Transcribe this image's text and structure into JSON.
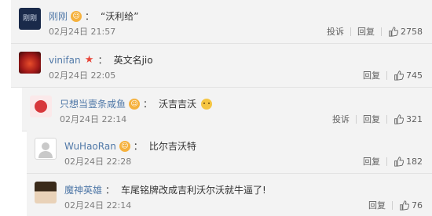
{
  "comments": [
    {
      "username": "刚刚",
      "text": "“沃利给”",
      "time": "02月24日 21:57",
      "actions": [
        "投诉",
        "回复"
      ],
      "likes": "2758",
      "avatar_label": "刚刚",
      "badge_color": "#f5b13d",
      "has_emoji": false
    },
    {
      "username": "vinifan",
      "text": "英文名jio",
      "time": "02月24日 22:05",
      "actions": [
        "回复"
      ],
      "likes": "745",
      "badge_color": "#e8463a",
      "has_emoji": false
    },
    {
      "username": "只想当壹条咸鱼",
      "text": "沃吉吉沃",
      "time": "02月24日 22:14",
      "actions": [
        "投诉",
        "回复"
      ],
      "likes": "321",
      "badge_color": "#f5b13d",
      "has_emoji": true
    },
    {
      "username": "WuHaoRan",
      "text": "比尔吉沃特",
      "time": "02月24日 22:28",
      "actions": [
        "回复"
      ],
      "likes": "182",
      "badge_color": "#f5b13d",
      "has_emoji": false
    },
    {
      "username": "魔神英雄",
      "text": "车尾铭牌改成吉利沃尔沃就牛逼了!",
      "time": "02月24日 22:14",
      "actions": [
        "回复"
      ],
      "likes": "76",
      "badge_color": "",
      "has_emoji": false
    }
  ]
}
